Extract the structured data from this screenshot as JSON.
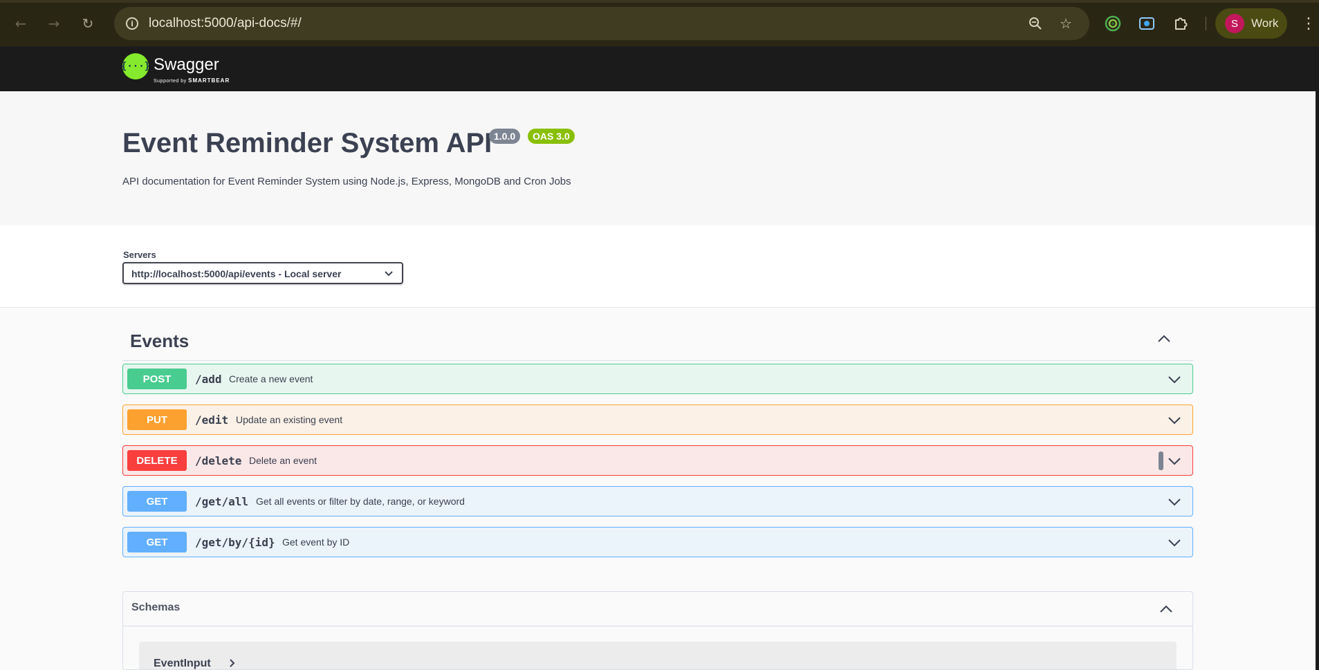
{
  "browser": {
    "url": "localhost:5000/api-docs/#/",
    "profile_initial": "S",
    "profile_name": "Work"
  },
  "swagger": {
    "logo_text": "Swagger",
    "logo_mark": "{···}",
    "logo_sub_prefix": "Supported by",
    "logo_sub_brand": "SMARTBEAR"
  },
  "info": {
    "title": "Event Reminder System API",
    "version_badge": "1.0.0",
    "oas_badge": "OAS 3.0",
    "description": "API documentation for Event Reminder System using Node.js, Express, MongoDB and Cron Jobs"
  },
  "servers": {
    "label": "Servers",
    "selected": "http://localhost:5000/api/events - Local server"
  },
  "tag": {
    "name": "Events"
  },
  "operations": [
    {
      "method": "POST",
      "path": "/add",
      "summary": "Create a new event",
      "color": "#49cc90"
    },
    {
      "method": "PUT",
      "path": "/edit",
      "summary": "Update an existing event",
      "color": "#fca130"
    },
    {
      "method": "DELETE",
      "path": "/delete",
      "summary": "Delete an event",
      "color": "#f93e3e"
    },
    {
      "method": "GET",
      "path": "/get/all",
      "summary": "Get all events or filter by date, range, or keyword",
      "color": "#61affe"
    },
    {
      "method": "GET",
      "path": "/get/by/{id}",
      "summary": "Get event by ID",
      "color": "#61affe"
    }
  ],
  "schemas": {
    "title": "Schemas",
    "items": [
      {
        "name": "EventInput"
      }
    ]
  },
  "icons": {
    "back": "arrow-left-icon",
    "forward": "arrow-right-icon",
    "reload": "reload-icon",
    "site_info": "info-icon",
    "zoom": "zoom-icon",
    "bookmark": "star-icon",
    "extensions": "puzzle-icon",
    "menu": "kebab-menu-icon"
  }
}
